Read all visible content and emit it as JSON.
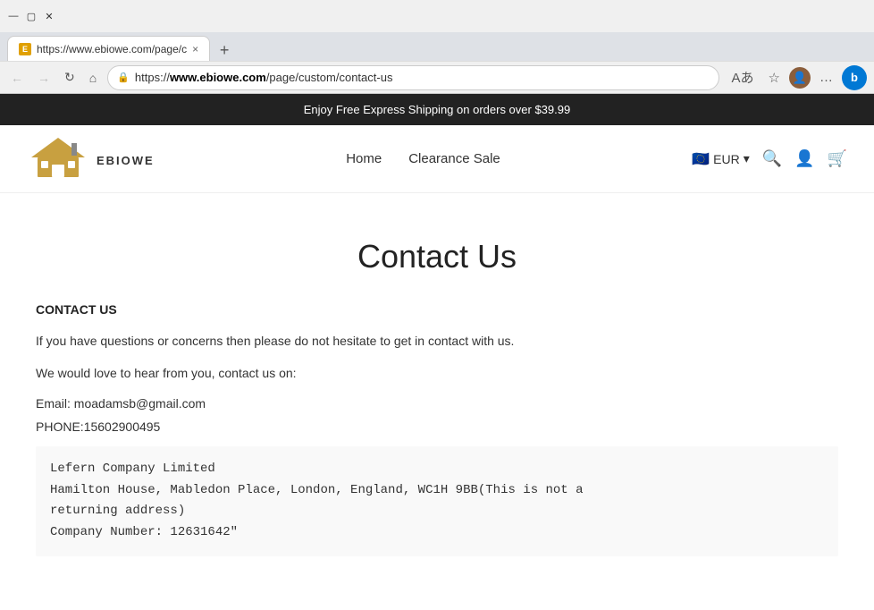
{
  "browser": {
    "tab": {
      "favicon_label": "E",
      "title": "https://www.ebiowe.com/page/c",
      "close_label": "×"
    },
    "new_tab_label": "+",
    "nav": {
      "back_label": "←",
      "forward_label": "→",
      "refresh_label": "↻",
      "home_label": "⌂"
    },
    "url": {
      "protocol": "https://",
      "domain": "www.ebiowe.com",
      "path": "/page/custom/contact-us"
    },
    "toolbar": {
      "translate_label": "A",
      "favorites_label": "☆",
      "more_label": "…",
      "bing_label": "b",
      "profile_label": "U"
    }
  },
  "site": {
    "banner": {
      "text": "Enjoy Free Express Shipping on orders over $39.99"
    },
    "header": {
      "logo_text": "EBIOWE",
      "nav_items": [
        {
          "label": "Home",
          "href": "/"
        },
        {
          "label": "Clearance Sale",
          "href": "/clearance"
        }
      ],
      "currency": {
        "flag": "🇪🇺",
        "label": "EUR",
        "chevron": "▾"
      },
      "icons": {
        "search": "🔍",
        "account": "👤",
        "cart": "🛒"
      }
    },
    "page": {
      "title": "Contact Us"
    },
    "contact": {
      "heading": "CONTACT US",
      "intro1": "If you have questions or concerns then please do not hesitate to get in contact with us.",
      "intro2": "We would love to hear from you, contact us on:",
      "email_label": "Email:",
      "email": "moadamsb@gmail.com",
      "phone_label": "PHONE:",
      "phone": "15602900495",
      "address_line1": "Lefern Company Limited",
      "address_line2": "Hamilton House, Mabledon Place, London, England, WC1H 9BB(This is not a",
      "address_line3": "returning address)",
      "address_line4": "Company Number: 12631642\""
    }
  }
}
